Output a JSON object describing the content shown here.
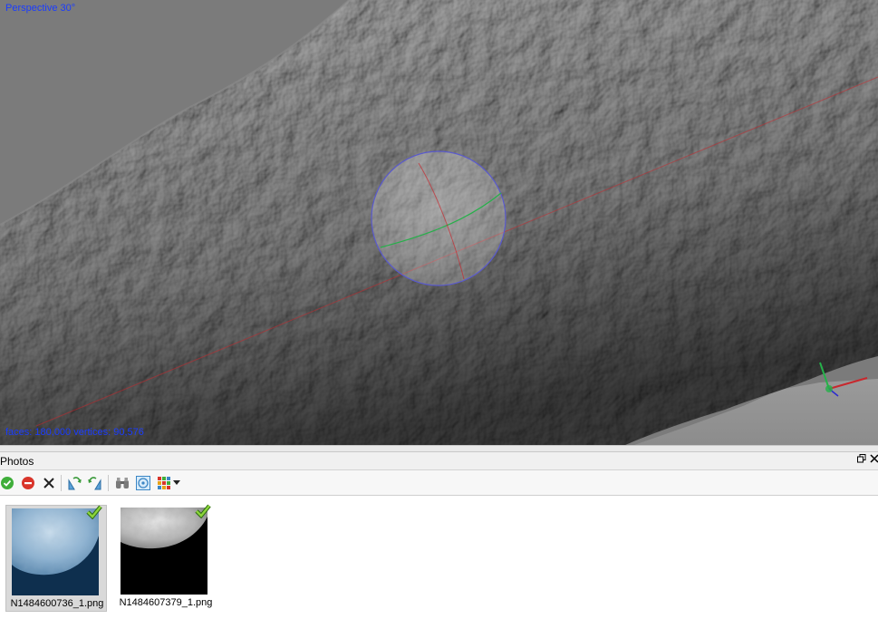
{
  "viewport": {
    "projection_label": "Perspective 30°",
    "stats_label": "faces: 180,000 vertices: 90,576"
  },
  "photos_panel": {
    "title": "Photos",
    "toolbar": [
      {
        "name": "enable-cameras-button",
        "icon": "green-check-circle"
      },
      {
        "name": "disable-cameras-button",
        "icon": "red-minus-circle"
      },
      {
        "name": "remove-cameras-button",
        "icon": "black-x"
      },
      {
        "name": "rotate-right-button",
        "icon": "rotate-right"
      },
      {
        "name": "rotate-left-button",
        "icon": "rotate-left"
      },
      {
        "name": "reset-view-button",
        "icon": "binoculars"
      },
      {
        "name": "camera-calibration-button",
        "icon": "calibration"
      },
      {
        "name": "view-mode-button",
        "icon": "grid-dropdown"
      }
    ],
    "photos": [
      {
        "filename": "N1484600736_1.png",
        "selected": true,
        "tint": "#3d6d94",
        "aligned": true
      },
      {
        "filename": "N1484607379_1.png",
        "selected": false,
        "tint": "#cfcfcf",
        "aligned": true
      }
    ]
  },
  "colors": {
    "overlay_text": "#1a3cff",
    "trackball_circle": "#5a5acc",
    "axis_red": "#c8282d",
    "axis_green": "#26b04a",
    "check_green": "#8bd43a"
  }
}
